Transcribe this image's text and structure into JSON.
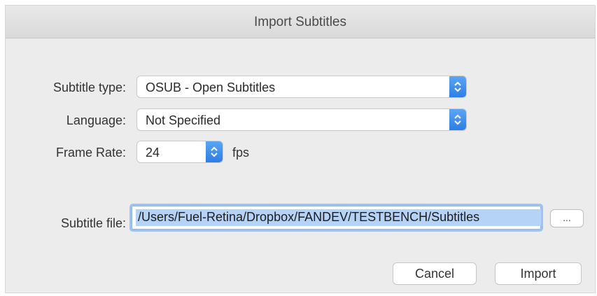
{
  "window": {
    "title": "Import Subtitles"
  },
  "form": {
    "subtitle_type": {
      "label": "Subtitle type:",
      "value": "OSUB - Open Subtitles"
    },
    "language": {
      "label": "Language:",
      "value": "Not Specified"
    },
    "frame_rate": {
      "label": "Frame Rate:",
      "value": "24",
      "unit": "fps"
    },
    "subtitle_file": {
      "label": "Subtitle file:",
      "value": "/Users/Fuel-Retina/Dropbox/FANDEV/TESTBENCH/Subtitles",
      "browse_label": "..."
    }
  },
  "buttons": {
    "cancel": "Cancel",
    "import": "Import"
  },
  "colors": {
    "accent": "#2d7ee6",
    "selection": "#b5d3f7",
    "dialog_bg": "#ececec"
  },
  "icons": {
    "popup_arrows": "chevron-up-down-icon"
  }
}
